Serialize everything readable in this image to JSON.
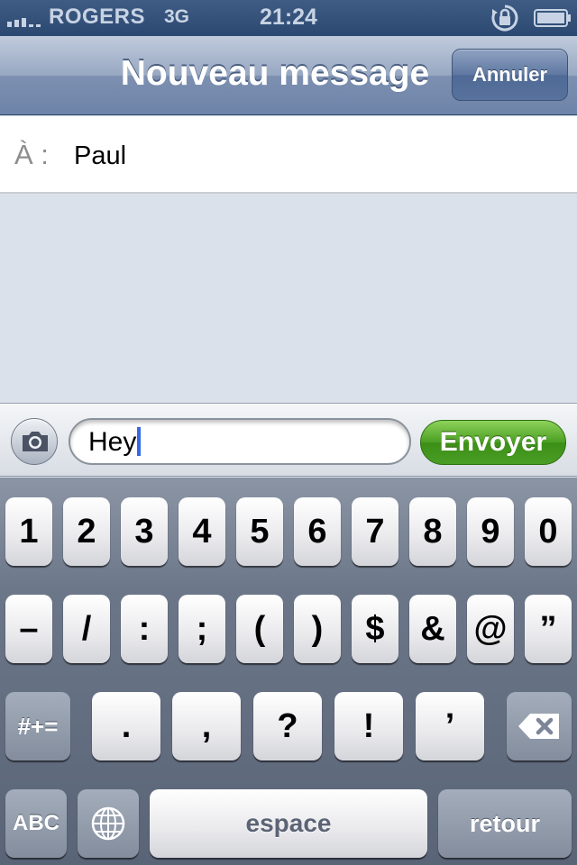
{
  "status_bar": {
    "carrier": "ROGERS",
    "network": "3G",
    "time": "21:24"
  },
  "nav_bar": {
    "title": "Nouveau message",
    "cancel_label": "Annuler"
  },
  "recipient": {
    "label": "À :",
    "value": "Paul"
  },
  "compose": {
    "text": "Hey",
    "send_label": "Envoyer"
  },
  "keyboard": {
    "row1": [
      "1",
      "2",
      "3",
      "4",
      "5",
      "6",
      "7",
      "8",
      "9",
      "0"
    ],
    "row2": [
      "–",
      "/",
      ":",
      ";",
      "(",
      ")",
      "$",
      "&",
      "@",
      "”"
    ],
    "row3": [
      ".",
      ",",
      "?",
      "!",
      "’"
    ],
    "symbols_label": "#+=",
    "abc_label": "ABC",
    "space_label": "espace",
    "return_label": "retour"
  },
  "icons": [
    "signal-icon",
    "orientation-lock-icon",
    "battery-icon",
    "camera-icon",
    "backspace-icon",
    "globe-icon"
  ],
  "colors": {
    "accent_send": "#4a9f23",
    "caret": "#3469e6"
  }
}
